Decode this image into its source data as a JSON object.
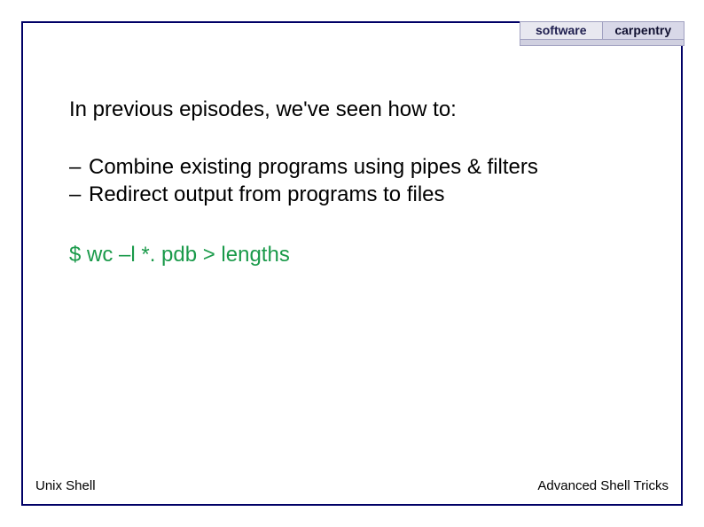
{
  "logo": {
    "left": "software",
    "right": "carpentry",
    "sub": ""
  },
  "content": {
    "intro": "In previous episodes, we've seen how to:",
    "bullets": [
      "Combine existing programs using pipes & filters",
      "Redirect output from programs to files"
    ],
    "code": "$ wc –l *. pdb > lengths"
  },
  "footer": {
    "left": "Unix Shell",
    "right": "Advanced Shell Tricks"
  }
}
